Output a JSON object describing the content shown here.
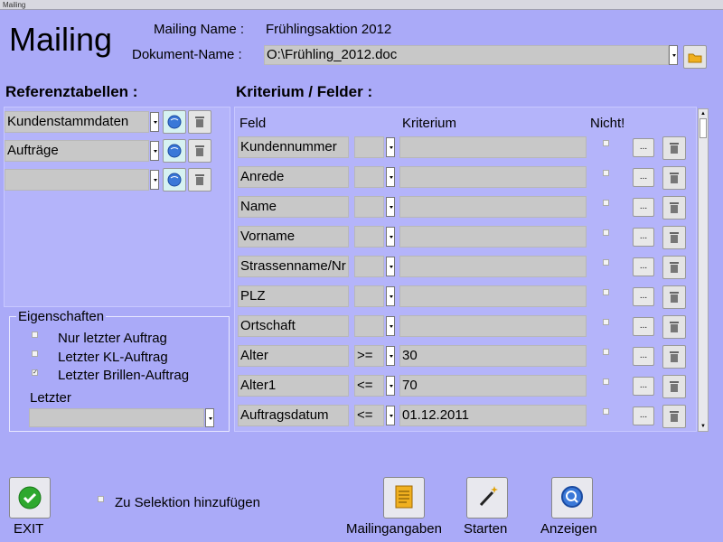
{
  "window": {
    "title": "Mailing"
  },
  "header": {
    "big_title": "Mailing",
    "mailing_name_label": "Mailing Name :",
    "mailing_name_value": "Frühlingsaktion 2012",
    "document_name_label": "Dokument-Name :",
    "document_name_value": "O:\\Frühling_2012.doc"
  },
  "referenz": {
    "title": "Referenztabellen :",
    "rows": [
      {
        "value": "Kundenstammdaten"
      },
      {
        "value": "Aufträge"
      },
      {
        "value": ""
      }
    ]
  },
  "eigenschaften": {
    "title": "Eigenschaften",
    "options": [
      {
        "label": "Nur letzter Auftrag",
        "checked": ""
      },
      {
        "label": "Letzter KL-Auftrag",
        "checked": ""
      },
      {
        "label": "Letzter Brillen-Auftrag",
        "checked": "✓"
      }
    ],
    "letzter_label": "Letzter",
    "letzter_value": ""
  },
  "kriterium": {
    "title": "Kriterium / Felder :",
    "headers": {
      "feld": "Feld",
      "kriterium": "Kriterium",
      "nicht": "Nicht!"
    },
    "rows": [
      {
        "feld": "Kundennummer",
        "op": "",
        "value": ""
      },
      {
        "feld": "Anrede",
        "op": "",
        "value": ""
      },
      {
        "feld": "Name",
        "op": "",
        "value": ""
      },
      {
        "feld": "Vorname",
        "op": "",
        "value": ""
      },
      {
        "feld": "Strassenname/Nr",
        "op": "",
        "value": ""
      },
      {
        "feld": "PLZ",
        "op": "",
        "value": ""
      },
      {
        "feld": "Ortschaft",
        "op": "",
        "value": ""
      },
      {
        "feld": "Alter",
        "op": ">=",
        "value": "30"
      },
      {
        "feld": "Alter1",
        "op": "<=",
        "value": "70"
      },
      {
        "feld": "Auftragsdatum",
        "op": "<=",
        "value": "01.12.2011"
      }
    ],
    "ellipsis": "..."
  },
  "footer": {
    "exit_label": "EXIT",
    "zu_selektion_label": "Zu Selektion hinzufügen",
    "mailingangaben_label": "Mailingangaben",
    "starten_label": "Starten",
    "anzeigen_label": "Anzeigen"
  },
  "colors": {
    "background": "#aaaaf8",
    "field": "#c8c8c8",
    "exit_green": "#2ea82e",
    "globe_blue": "#3a78d8"
  }
}
